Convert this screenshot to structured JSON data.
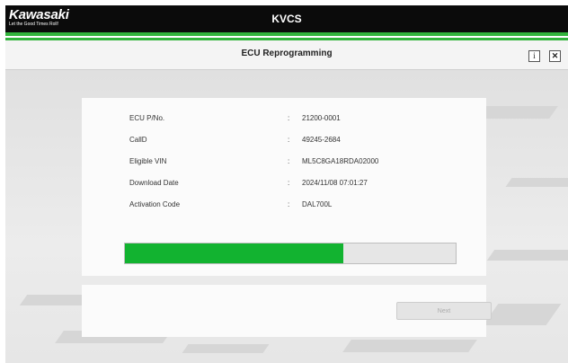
{
  "header": {
    "logo_name": "Kawasaki",
    "logo_tagline": "Let the Good Times Roll!",
    "app_title": "KVCS"
  },
  "titlebar": {
    "title": "ECU Reprogramming",
    "info_glyph": "i",
    "close_glyph": "✕"
  },
  "info": {
    "rows": [
      {
        "label": "ECU P/No.",
        "separator": ":",
        "value": "21200-0001"
      },
      {
        "label": "CallD",
        "separator": ":",
        "value": "49245-2684"
      },
      {
        "label": "Eligible VIN",
        "separator": ":",
        "value": "ML5C8GA18RDA02000"
      },
      {
        "label": "Download Date",
        "separator": ":",
        "value": "2024/11/08 07:01:27"
      },
      {
        "label": "Activation Code",
        "separator": ":",
        "value": "DAL700L"
      }
    ]
  },
  "progress": {
    "fraction": 0.66
  },
  "actions": {
    "next_label": "Next",
    "next_enabled": false
  },
  "colors": {
    "header_bg": "#0b0b0b",
    "accent_green": "#32b43c",
    "progress_fill": "#12b330",
    "progress_track": "#e6e6e6"
  },
  "icons": [
    "info-icon",
    "close-icon"
  ]
}
